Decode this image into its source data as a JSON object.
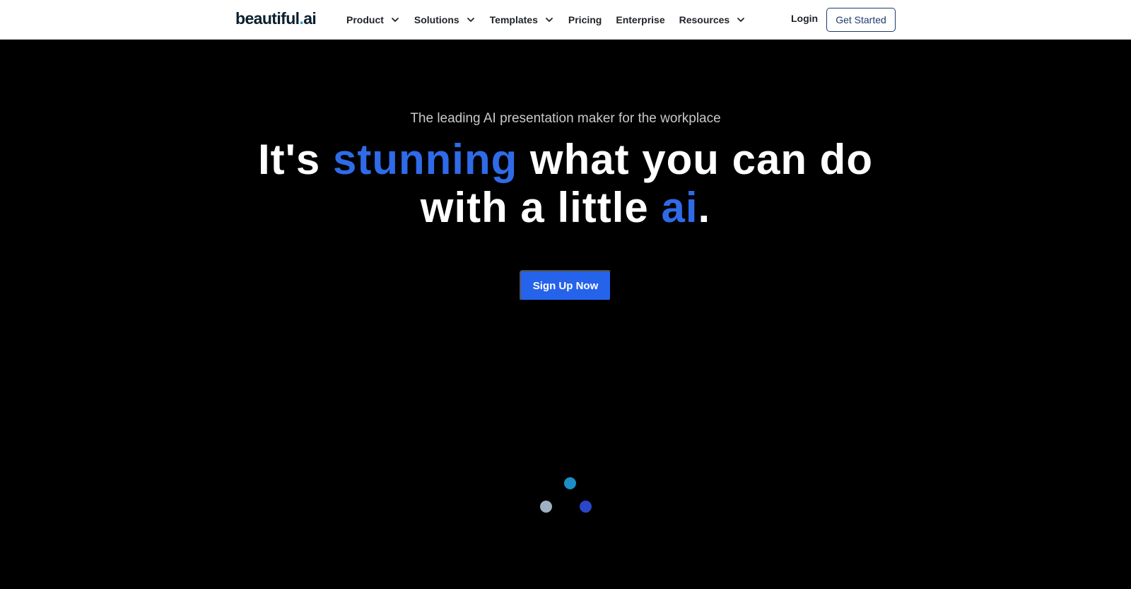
{
  "brand": {
    "name_main": "beautiful",
    "name_dot": ".",
    "name_tld": "ai"
  },
  "nav": {
    "items": [
      {
        "label": "Product",
        "has_dropdown": true,
        "icon": "chevron-down-icon"
      },
      {
        "label": "Solutions",
        "has_dropdown": true,
        "icon": "chevron-down-icon"
      },
      {
        "label": "Templates",
        "has_dropdown": true,
        "icon": "chevron-down-icon"
      },
      {
        "label": "Pricing",
        "has_dropdown": false
      },
      {
        "label": "Enterprise",
        "has_dropdown": false
      },
      {
        "label": "Resources",
        "has_dropdown": true,
        "icon": "chevron-down-icon"
      }
    ],
    "login_label": "Login",
    "cta_label": "Get Started"
  },
  "hero": {
    "tagline": "The leading AI presentation maker for the workplace",
    "headline": {
      "part1": "It's ",
      "accent1": "stunning",
      "part2": " what you can do",
      "part3": "with a little ",
      "accent2": "ai",
      "part4": "."
    },
    "signup_label": "Sign Up Now"
  },
  "loader": {
    "balls": [
      {
        "color": "#1b8fc6"
      },
      {
        "color": "#9fb0c2"
      },
      {
        "color": "#2a47c9"
      }
    ]
  },
  "colors": {
    "accent": "#2f6be8",
    "button": "#2563eb",
    "brand_dot": "#1ea3e1",
    "background": "#000000",
    "nav_background": "#ffffff"
  }
}
